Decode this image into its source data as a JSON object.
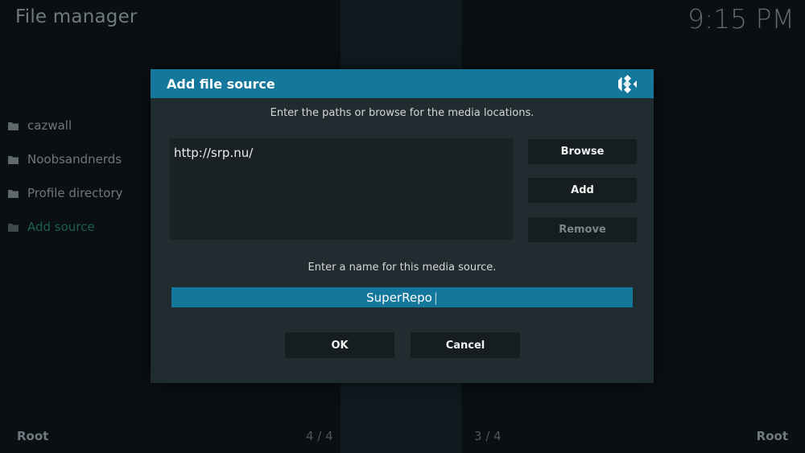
{
  "header": {
    "title": "File manager",
    "clock": "9:15 PM"
  },
  "sources": [
    {
      "label": "cazwall"
    },
    {
      "label": "Noobsandnerds"
    },
    {
      "label": "Profile directory"
    },
    {
      "label": "Add source"
    }
  ],
  "footer": {
    "left": "Root",
    "right": "Root",
    "count_left": "4 / 4",
    "count_right": "3 / 4"
  },
  "dialog": {
    "title": "Add file source",
    "path_prompt": "Enter the paths or browse for the media locations.",
    "paths": [
      "http://srp.nu/"
    ],
    "buttons": {
      "browse": "Browse",
      "add": "Add",
      "remove": "Remove"
    },
    "name_prompt": "Enter a name for this media source.",
    "name_value": "SuperRepo",
    "ok": "OK",
    "cancel": "Cancel"
  },
  "colors": {
    "accent": "#14779c",
    "dialog_bg": "#212c30",
    "highlight_text": "#1d5f4c"
  },
  "icons": {
    "folder": "folder-icon",
    "logo": "kodi-logo-icon"
  }
}
